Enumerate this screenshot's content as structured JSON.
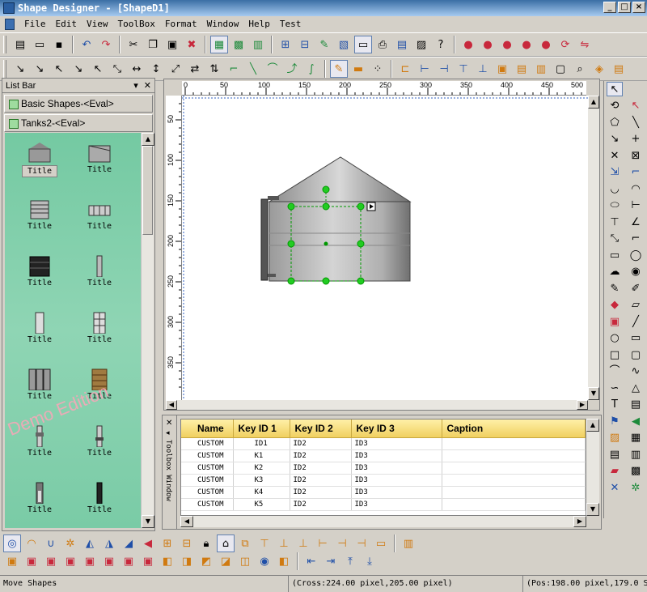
{
  "window": {
    "title": "Shape Designer - [ShapeD1]",
    "min": "_",
    "max": "□",
    "close": "×"
  },
  "menu": [
    "File",
    "Edit",
    "View",
    "ToolBox",
    "Format",
    "Window",
    "Help",
    "Test"
  ],
  "list_bar": {
    "title": "List Bar",
    "categories": [
      "Basic Shapes-<Eval>",
      "Tanks2-<Eval>"
    ],
    "items": [
      "Title",
      "Title",
      "Title",
      "Title",
      "Title",
      "Title",
      "Title",
      "Title",
      "Title",
      "Title",
      "Title",
      "Title",
      "Title",
      "Title"
    ],
    "watermark": "Demo Edition"
  },
  "rulers": {
    "h": [
      "0",
      "50",
      "100",
      "150",
      "200",
      "250",
      "300",
      "350",
      "400",
      "450",
      "500"
    ],
    "v": [
      "50",
      "100",
      "150",
      "200",
      "250",
      "300",
      "350"
    ]
  },
  "toolbox_window": {
    "tab": "Toolbox Window",
    "columns": [
      "Name",
      "Key ID 1",
      "Key ID 2",
      "Key ID 3",
      "Caption"
    ],
    "rows": [
      [
        "CUSTOM",
        "ID1",
        "ID2",
        "ID3",
        ""
      ],
      [
        "CUSTOM",
        "K1",
        "ID2",
        "ID3",
        ""
      ],
      [
        "CUSTOM",
        "K2",
        "ID2",
        "ID3",
        ""
      ],
      [
        "CUSTOM",
        "K3",
        "ID2",
        "ID3",
        ""
      ],
      [
        "CUSTOM",
        "K4",
        "ID2",
        "ID3",
        ""
      ],
      [
        "CUSTOM",
        "K5",
        "ID2",
        "ID3",
        ""
      ]
    ]
  },
  "status": {
    "left": "Move Shapes",
    "middle": "(Cross:224.00 pixel,205.00 pixel)",
    "right": "(Pos:198.00 pixel,179.0 SS"
  }
}
